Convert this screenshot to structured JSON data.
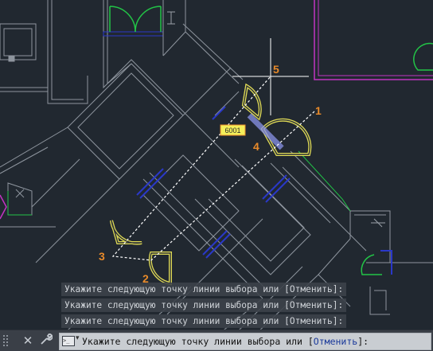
{
  "drawing": {
    "markers": [
      "1",
      "2",
      "3",
      "4",
      "5"
    ],
    "door_tag": "6001",
    "colors": {
      "background": "#212830",
      "walls": "#8e959e",
      "highlight": "#f5ef5a",
      "window": "#2a38c8",
      "green": "#22c447",
      "magenta": "#c334c3",
      "marker": "#e88a2a",
      "selection_line": "#ffffff"
    }
  },
  "command_history": [
    "Укажите следующую точку линии выбора или [Отменить]:",
    "Укажите следующую точку линии выбора или [Отменить]:",
    "Укажите следующую точку линии выбора или [Отменить]:"
  ],
  "command_line": {
    "prompt_before": "Укажите следующую точку линии выбора или [",
    "option": "Отменить",
    "prompt_after": "]:",
    "icons": [
      "grip-icon",
      "close-icon",
      "wrench-icon",
      "command-prompt-icon"
    ]
  }
}
